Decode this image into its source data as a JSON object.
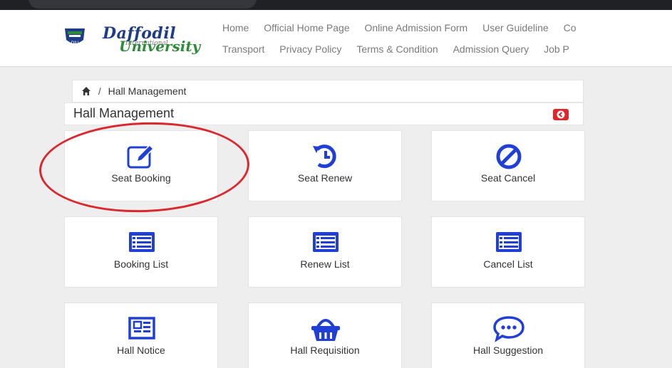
{
  "header": {
    "logo": {
      "name_line1": "Daffodil",
      "name_line2": "University",
      "subtitle": "International"
    },
    "nav_row1": [
      "Home",
      "Official Home Page",
      "Online Admission Form",
      "User Guideline",
      "Co"
    ],
    "nav_row2": [
      "Transport",
      "Privacy Policy",
      "Terms & Condition",
      "Admission Query",
      "Job P"
    ]
  },
  "breadcrumb": {
    "separator": "/",
    "current": "Hall Management"
  },
  "page": {
    "title": "Hall Management"
  },
  "tiles": [
    {
      "label": "Seat Booking",
      "icon": "edit-icon"
    },
    {
      "label": "Seat Renew",
      "icon": "renew-icon"
    },
    {
      "label": "Seat Cancel",
      "icon": "cancel-icon"
    },
    {
      "label": "Booking List",
      "icon": "list-icon"
    },
    {
      "label": "Renew List",
      "icon": "list-icon"
    },
    {
      "label": "Cancel List",
      "icon": "list-icon"
    },
    {
      "label": "Hall Notice",
      "icon": "newspaper-icon"
    },
    {
      "label": "Hall Requisition",
      "icon": "basket-icon"
    },
    {
      "label": "Hall Suggestion",
      "icon": "chat-icon"
    }
  ],
  "colors": {
    "icon": "#1f3fd6",
    "back_button": "#e0252b",
    "annotation": "#d9282e",
    "logo_blue": "#1f3c88",
    "logo_green": "#2e8b3a"
  }
}
